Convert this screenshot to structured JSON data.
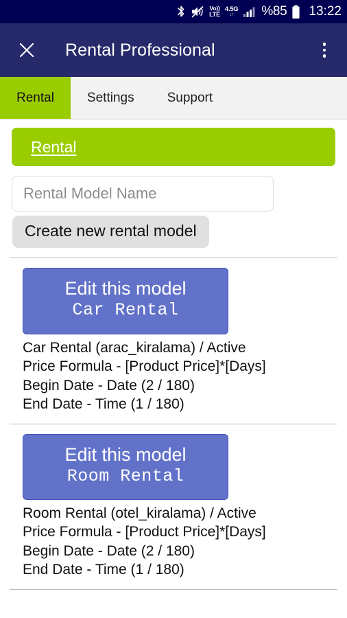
{
  "status_bar": {
    "icons": [
      "bluetooth-icon",
      "mute-icon",
      "volte-icon",
      "network-4.5g-icon",
      "signal-bars-icon"
    ],
    "volte_top": "Vo))",
    "volte_bottom": "LTE",
    "network_label": "4.5G",
    "network_arrows": "↓↑",
    "battery": "%85",
    "battery_icon": "battery-icon",
    "time": "13:22"
  },
  "header": {
    "close_icon": "close-icon",
    "title": "Rental Professional",
    "overflow_icon": "overflow-menu-icon"
  },
  "tabs": [
    {
      "label": "Rental",
      "active": true
    },
    {
      "label": "Settings",
      "active": false
    },
    {
      "label": "Support",
      "active": false
    }
  ],
  "banner": {
    "label": "Rental"
  },
  "form": {
    "input_placeholder": "Rental Model Name",
    "input_value": "",
    "create_button_label": "Create new rental model"
  },
  "models": [
    {
      "button_title": "Edit this model",
      "button_name": "Car Rental",
      "details": [
        "Car Rental (arac_kiralama) / Active",
        "Price Formula - [Product Price]*[Days]",
        "Begin Date - Date (2 / 180)",
        "End Date - Time (1 / 180)"
      ]
    },
    {
      "button_title": "Edit this model",
      "button_name": "Room Rental",
      "details": [
        "Room Rental (otel_kiralama) / Active",
        "Price Formula - [Product Price]*[Days]",
        "Begin Date - Date (2 / 180)",
        "End Date - Time (1 / 180)"
      ]
    }
  ],
  "colors": {
    "status_bar": "#000052",
    "header": "#262a6b",
    "accent_green": "#9acd00",
    "button_blue": "#6272c8",
    "tab_bar": "#f2f2f2",
    "create_button": "#e0e0e0"
  }
}
